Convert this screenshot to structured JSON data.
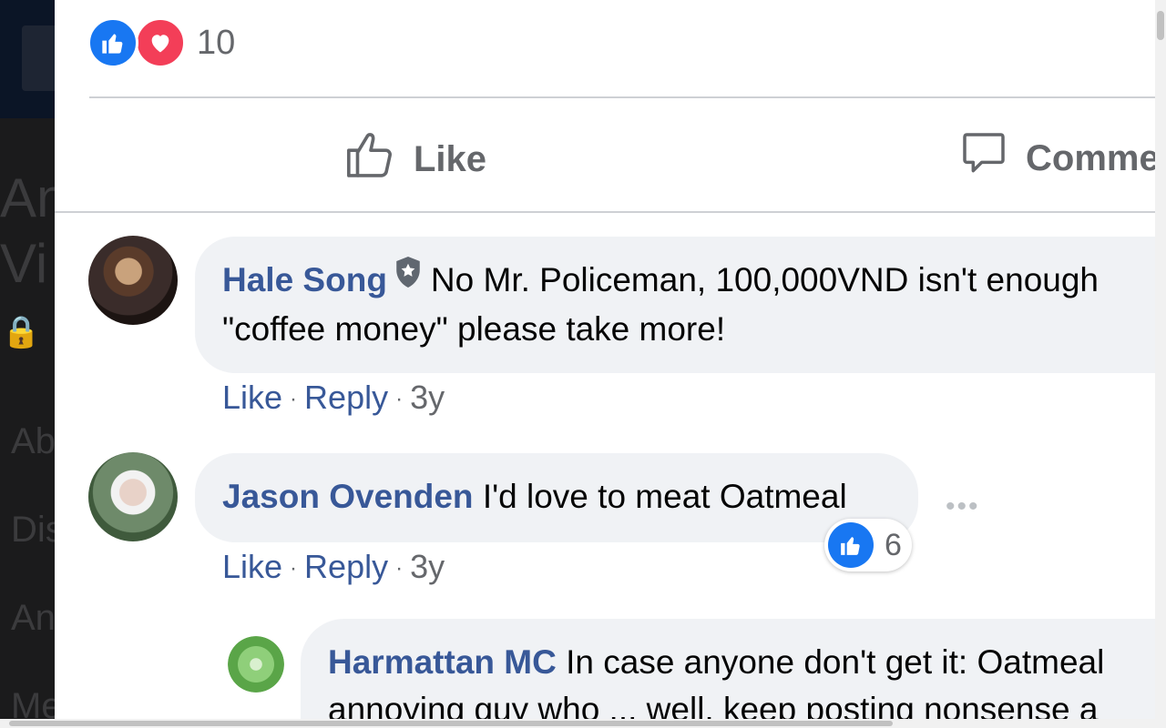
{
  "background_page": {
    "title_line1": "An",
    "title_line2": "Vi",
    "lock_glyph": "🔒",
    "nav_items": [
      "Ab",
      "Dis",
      "An",
      "Me"
    ]
  },
  "post": {
    "reaction_count": "10",
    "reaction_icons": [
      "like-icon",
      "love-icon"
    ],
    "actions": {
      "like_label": "Like",
      "comment_label": "Comme"
    }
  },
  "comments": [
    {
      "author": "Hale Song",
      "badge": "shield-icon",
      "text_line1": "No Mr. Policeman, 100,000VND isn't enough",
      "text_line2": "\"coffee money\" please take more!",
      "like_label": "Like",
      "reply_label": "Reply",
      "time": "3y"
    },
    {
      "author": "Jason Ovenden",
      "text_line1": "I'd love to meat Oatmeal",
      "like_label": "Like",
      "reply_label": "Reply",
      "time": "3y",
      "reaction_count": "6",
      "more": "•••"
    },
    {
      "author": "Harmattan MC",
      "text_line1": "In case anyone don't get it: Oatmeal",
      "text_line2": "annoying guy who ... well, keep posting nonsense a"
    }
  ],
  "separator": "·",
  "colors": {
    "link": "#385898",
    "like_blue": "#1877f2",
    "love_red": "#f33e58",
    "bubble": "#f0f2f5",
    "muted": "#65676b"
  }
}
